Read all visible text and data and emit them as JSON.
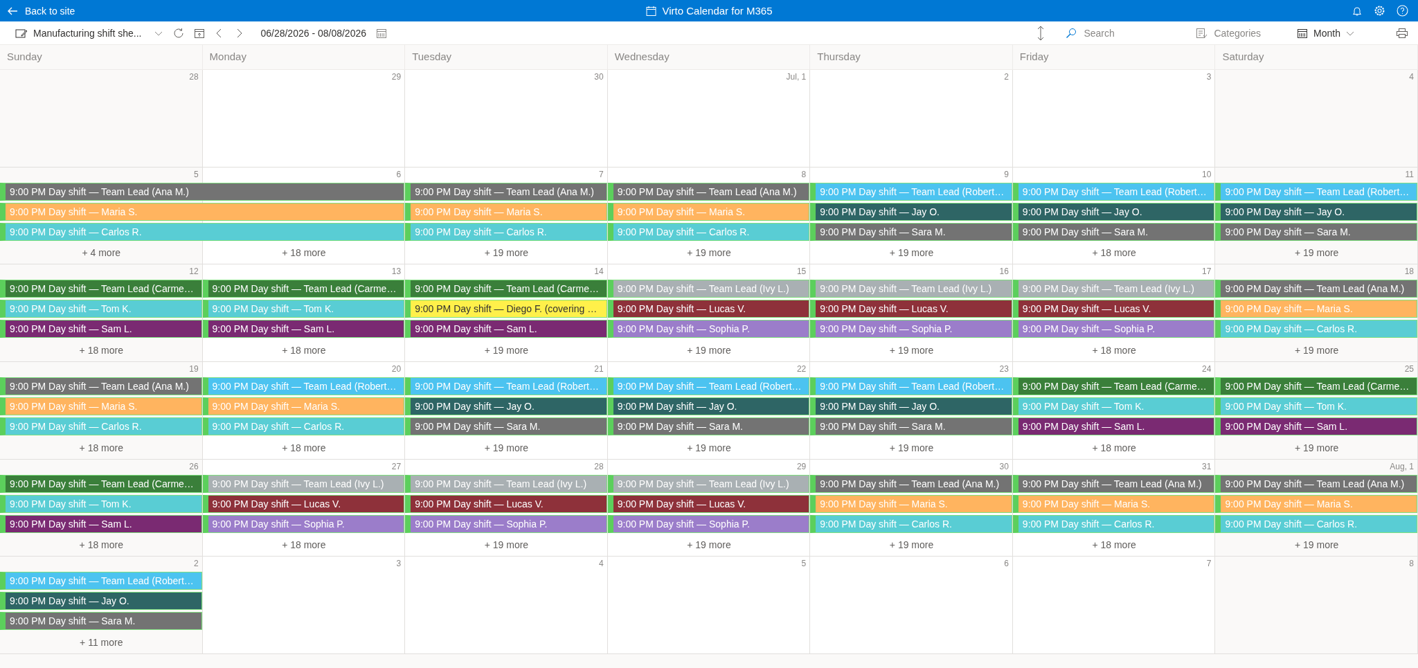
{
  "app_bar": {
    "back": "Back to site",
    "title": "Virto Calendar for M365"
  },
  "toolbar": {
    "calendar_name": "Manufacturing shift she...",
    "date_range": "06/28/2026 - 08/08/2026",
    "search": {
      "placeholder": "Search"
    },
    "categories": "Categories",
    "view": "Month"
  },
  "weekdays": [
    "Sunday",
    "Monday",
    "Tuesday",
    "Wednesday",
    "Thursday",
    "Friday",
    "Saturday"
  ],
  "weeks": [
    {
      "days": [
        {
          "date": "28"
        },
        {
          "date": "29"
        },
        {
          "date": "30"
        },
        {
          "date": "Jul, 1"
        },
        {
          "date": "2"
        },
        {
          "date": "3"
        },
        {
          "date": "4"
        }
      ]
    },
    {
      "days": [
        {
          "date": "5",
          "events": [
            {
              "text": "9:00 PM Day shift — Team Lead (Ana M.)",
              "color": "#737373",
              "continues_next_day": true
            },
            {
              "text": "9:00 PM Day shift — Maria S.",
              "color": "#ffb45f",
              "continues_next_day": true
            },
            {
              "text": "9:00 PM Day shift — Carlos R.",
              "color": "#59cdd4",
              "continues_next_day": true
            }
          ],
          "more": "+ 4 more"
        },
        {
          "date": "6",
          "more": "+ 18 more"
        },
        {
          "date": "7",
          "events": [
            {
              "text": "9:00 PM Day shift — Team Lead (Ana M.)",
              "color": "#737373"
            },
            {
              "text": "9:00 PM Day shift — Maria S.",
              "color": "#ffb45f"
            },
            {
              "text": "9:00 PM Day shift — Carlos R.",
              "color": "#59cdd4"
            }
          ],
          "more": "+ 19 more"
        },
        {
          "date": "8",
          "events": [
            {
              "text": "9:00 PM Day shift — Team Lead (Ana M.)",
              "color": "#737373"
            },
            {
              "text": "9:00 PM Day shift — Maria S.",
              "color": "#ffb45f"
            },
            {
              "text": "9:00 PM Day shift — Carlos R.",
              "color": "#59cdd4"
            }
          ],
          "more": "+ 19 more"
        },
        {
          "date": "9",
          "events": [
            {
              "text": "9:00 PM Day shift — Team Lead (Robert…",
              "color": "#4cc3f0"
            },
            {
              "text": "9:00 PM Day shift — Jay O.",
              "color": "#2e6565"
            },
            {
              "text": "9:00 PM Day shift — Sara M.",
              "color": "#737373"
            }
          ],
          "more": "+ 19 more"
        },
        {
          "date": "10",
          "events": [
            {
              "text": "9:00 PM Day shift — Team Lead (Robert…",
              "color": "#4cc3f0"
            },
            {
              "text": "9:00 PM Day shift — Jay O.",
              "color": "#2e6565"
            },
            {
              "text": "9:00 PM Day shift — Sara M.",
              "color": "#737373"
            }
          ],
          "more": "+ 18 more"
        },
        {
          "date": "11",
          "events": [
            {
              "text": "9:00 PM Day shift — Team Lead (Robert…",
              "color": "#4cc3f0"
            },
            {
              "text": "9:00 PM Day shift — Jay O.",
              "color": "#2e6565"
            },
            {
              "text": "9:00 PM Day shift — Sara M.",
              "color": "#737373"
            }
          ],
          "more": "+ 19 more"
        }
      ]
    },
    {
      "days": [
        {
          "date": "12",
          "events": [
            {
              "text": "9:00 PM Day shift — Team Lead (Carme…",
              "color": "#3a7f3a"
            },
            {
              "text": "9:00 PM Day shift — Tom K.",
              "color": "#59cdd4"
            },
            {
              "text": "9:00 PM Day shift — Sam L.",
              "color": "#7a2a72"
            }
          ],
          "more": "+ 18 more"
        },
        {
          "date": "13",
          "events": [
            {
              "text": "9:00 PM Day shift — Team Lead (Carme…",
              "color": "#3a7f3a"
            },
            {
              "text": "9:00 PM Day shift — Tom K.",
              "color": "#59cdd4"
            },
            {
              "text": "9:00 PM Day shift — Sam L.",
              "color": "#7a2a72"
            }
          ],
          "more": "+ 18 more"
        },
        {
          "date": "14",
          "events": [
            {
              "text": "9:00 PM Day shift — Team Lead (Carme…",
              "color": "#3a7f3a"
            },
            {
              "text": "9:00 PM Day shift — Diego F. (covering …",
              "color": "#fff04a"
            },
            {
              "text": "9:00 PM Day shift — Sam L.",
              "color": "#7a2a72"
            }
          ],
          "more": "+ 19 more"
        },
        {
          "date": "15",
          "events": [
            {
              "text": "9:00 PM Day shift — Team Lead (Ivy L.)",
              "color": "#a9b0b3"
            },
            {
              "text": "9:00 PM Day shift — Lucas V.",
              "color": "#8e313a"
            },
            {
              "text": "9:00 PM Day shift — Sophia P.",
              "color": "#9b7dca"
            }
          ],
          "more": "+ 19 more"
        },
        {
          "date": "16",
          "events": [
            {
              "text": "9:00 PM Day shift — Team Lead (Ivy L.)",
              "color": "#a9b0b3"
            },
            {
              "text": "9:00 PM Day shift — Lucas V.",
              "color": "#8e313a"
            },
            {
              "text": "9:00 PM Day shift — Sophia P.",
              "color": "#9b7dca"
            }
          ],
          "more": "+ 19 more"
        },
        {
          "date": "17",
          "events": [
            {
              "text": "9:00 PM Day shift — Team Lead (Ivy L.)",
              "color": "#a9b0b3"
            },
            {
              "text": "9:00 PM Day shift — Lucas V.",
              "color": "#8e313a"
            },
            {
              "text": "9:00 PM Day shift — Sophia P.",
              "color": "#9b7dca"
            }
          ],
          "more": "+ 18 more"
        },
        {
          "date": "18",
          "events": [
            {
              "text": "9:00 PM Day shift — Team Lead (Ana M.)",
              "color": "#737373"
            },
            {
              "text": "9:00 PM Day shift — Maria S.",
              "color": "#ffb45f"
            },
            {
              "text": "9:00 PM Day shift — Carlos R.",
              "color": "#59cdd4"
            }
          ],
          "more": "+ 19 more"
        }
      ]
    },
    {
      "days": [
        {
          "date": "19",
          "events": [
            {
              "text": "9:00 PM Day shift — Team Lead (Ana M.)",
              "color": "#737373"
            },
            {
              "text": "9:00 PM Day shift — Maria S.",
              "color": "#ffb45f"
            },
            {
              "text": "9:00 PM Day shift — Carlos R.",
              "color": "#59cdd4"
            }
          ],
          "more": "+ 18 more"
        },
        {
          "date": "20",
          "events": [
            {
              "text": "9:00 PM Day shift — Team Lead (Robert…",
              "color": "#4cc3f0"
            },
            {
              "text": "9:00 PM Day shift — Maria S.",
              "color": "#ffb45f"
            },
            {
              "text": "9:00 PM Day shift — Carlos R.",
              "color": "#59cdd4"
            }
          ],
          "more": "+ 18 more"
        },
        {
          "date": "21",
          "events": [
            {
              "text": "9:00 PM Day shift — Team Lead (Robert…",
              "color": "#4cc3f0"
            },
            {
              "text": "9:00 PM Day shift — Jay O.",
              "color": "#2e6565"
            },
            {
              "text": "9:00 PM Day shift — Sara M.",
              "color": "#737373"
            }
          ],
          "more": "+ 19 more"
        },
        {
          "date": "22",
          "events": [
            {
              "text": "9:00 PM Day shift — Team Lead (Robert…",
              "color": "#4cc3f0"
            },
            {
              "text": "9:00 PM Day shift — Jay O.",
              "color": "#2e6565"
            },
            {
              "text": "9:00 PM Day shift — Sara M.",
              "color": "#737373"
            }
          ],
          "more": "+ 19 more"
        },
        {
          "date": "23",
          "events": [
            {
              "text": "9:00 PM Day shift — Team Lead (Robert…",
              "color": "#4cc3f0"
            },
            {
              "text": "9:00 PM Day shift — Jay O.",
              "color": "#2e6565"
            },
            {
              "text": "9:00 PM Day shift — Sara M.",
              "color": "#737373"
            }
          ],
          "more": "+ 19 more"
        },
        {
          "date": "24",
          "events": [
            {
              "text": "9:00 PM Day shift — Team Lead (Carme…",
              "color": "#3a7f3a"
            },
            {
              "text": "9:00 PM Day shift — Tom K.",
              "color": "#59cdd4"
            },
            {
              "text": "9:00 PM Day shift — Sam L.",
              "color": "#7a2a72"
            }
          ],
          "more": "+ 18 more"
        },
        {
          "date": "25",
          "events": [
            {
              "text": "9:00 PM Day shift — Team Lead (Carme…",
              "color": "#3a7f3a"
            },
            {
              "text": "9:00 PM Day shift — Tom K.",
              "color": "#59cdd4"
            },
            {
              "text": "9:00 PM Day shift — Sam L.",
              "color": "#7a2a72"
            }
          ],
          "more": "+ 19 more"
        }
      ]
    },
    {
      "days": [
        {
          "date": "26",
          "events": [
            {
              "text": "9:00 PM Day shift — Team Lead (Carme…",
              "color": "#3a7f3a"
            },
            {
              "text": "9:00 PM Day shift — Tom K.",
              "color": "#59cdd4"
            },
            {
              "text": "9:00 PM Day shift — Sam L.",
              "color": "#7a2a72"
            }
          ],
          "more": "+ 18 more"
        },
        {
          "date": "27",
          "events": [
            {
              "text": "9:00 PM Day shift — Team Lead (Ivy L.)",
              "color": "#a9b0b3"
            },
            {
              "text": "9:00 PM Day shift — Lucas V.",
              "color": "#8e313a"
            },
            {
              "text": "9:00 PM Day shift — Sophia P.",
              "color": "#9b7dca"
            }
          ],
          "more": "+ 18 more"
        },
        {
          "date": "28",
          "events": [
            {
              "text": "9:00 PM Day shift — Team Lead (Ivy L.)",
              "color": "#a9b0b3"
            },
            {
              "text": "9:00 PM Day shift — Lucas V.",
              "color": "#8e313a"
            },
            {
              "text": "9:00 PM Day shift — Sophia P.",
              "color": "#9b7dca"
            }
          ],
          "more": "+ 19 more"
        },
        {
          "date": "29",
          "events": [
            {
              "text": "9:00 PM Day shift — Team Lead (Ivy L.)",
              "color": "#a9b0b3"
            },
            {
              "text": "9:00 PM Day shift — Lucas V.",
              "color": "#8e313a"
            },
            {
              "text": "9:00 PM Day shift — Sophia P.",
              "color": "#9b7dca"
            }
          ],
          "more": "+ 19 more"
        },
        {
          "date": "30",
          "events": [
            {
              "text": "9:00 PM Day shift — Team Lead (Ana M.)",
              "color": "#737373"
            },
            {
              "text": "9:00 PM Day shift — Maria S.",
              "color": "#ffb45f"
            },
            {
              "text": "9:00 PM Day shift — Carlos R.",
              "color": "#59cdd4"
            }
          ],
          "more": "+ 19 more"
        },
        {
          "date": "31",
          "events": [
            {
              "text": "9:00 PM Day shift — Team Lead (Ana M.)",
              "color": "#737373"
            },
            {
              "text": "9:00 PM Day shift — Maria S.",
              "color": "#ffb45f"
            },
            {
              "text": "9:00 PM Day shift — Carlos R.",
              "color": "#59cdd4"
            }
          ],
          "more": "+ 18 more"
        },
        {
          "date": "Aug, 1",
          "events": [
            {
              "text": "9:00 PM Day shift — Team Lead (Ana M.)",
              "color": "#737373"
            },
            {
              "text": "9:00 PM Day shift — Maria S.",
              "color": "#ffb45f"
            },
            {
              "text": "9:00 PM Day shift — Carlos R.",
              "color": "#59cdd4"
            }
          ],
          "more": "+ 19 more"
        }
      ]
    },
    {
      "days": [
        {
          "date": "2",
          "events": [
            {
              "text": "9:00 PM Day shift — Team Lead (Robert…",
              "color": "#4cc3f0"
            },
            {
              "text": "9:00 PM Day shift — Jay O.",
              "color": "#2e6565"
            },
            {
              "text": "9:00 PM Day shift — Sara M.",
              "color": "#737373"
            }
          ],
          "more": "+ 11 more"
        },
        {
          "date": "3"
        },
        {
          "date": "4"
        },
        {
          "date": "5"
        },
        {
          "date": "6"
        },
        {
          "date": "7"
        },
        {
          "date": "8"
        }
      ]
    }
  ]
}
